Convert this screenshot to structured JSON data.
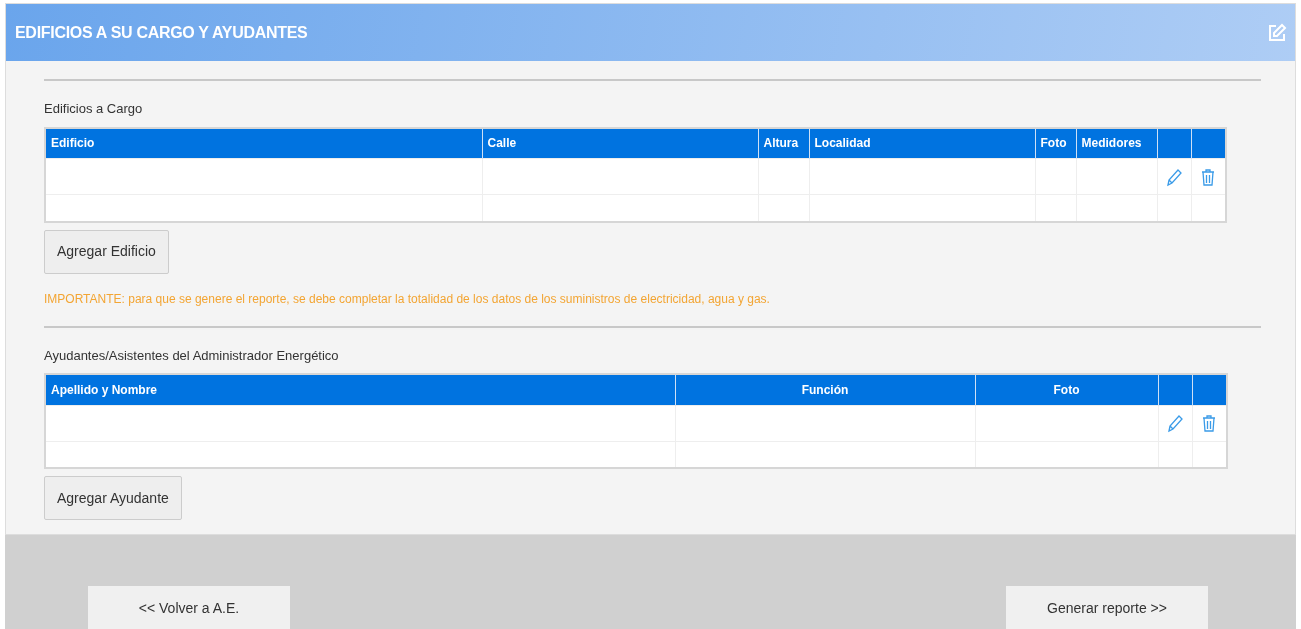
{
  "panel": {
    "title": "EDIFICIOS A SU CARGO Y AYUDANTES"
  },
  "sections": [
    {
      "label": "Edificios a Cargo",
      "table": {
        "columns": [
          {
            "label": "Edificio"
          },
          {
            "label": "Calle"
          },
          {
            "label": "Altura"
          },
          {
            "label": "Localidad"
          },
          {
            "label": "Foto"
          },
          {
            "label": "Medidores"
          }
        ],
        "rows": [
          {
            "actions": true
          },
          {
            "actions": false
          }
        ]
      },
      "button": "Agregar Edificio",
      "note": "IMPORTANTE: para que se genere el reporte, se debe completar la totalidad de los datos de los suministros de electricidad, agua y gas."
    },
    {
      "label": "Ayudantes/Asistentes del Administrador Energético",
      "table": {
        "columns": [
          {
            "label": "Apellido y Nombre",
            "centered": false
          },
          {
            "label": "Función",
            "centered": true
          },
          {
            "label": "Foto",
            "centered": true
          }
        ],
        "rows": [
          {
            "actions": true
          },
          {
            "actions": false
          }
        ]
      },
      "button": "Agregar Ayudante"
    }
  ],
  "footer": {
    "back": "<< Volver a A.E.",
    "next": "Generar reporte >>"
  }
}
